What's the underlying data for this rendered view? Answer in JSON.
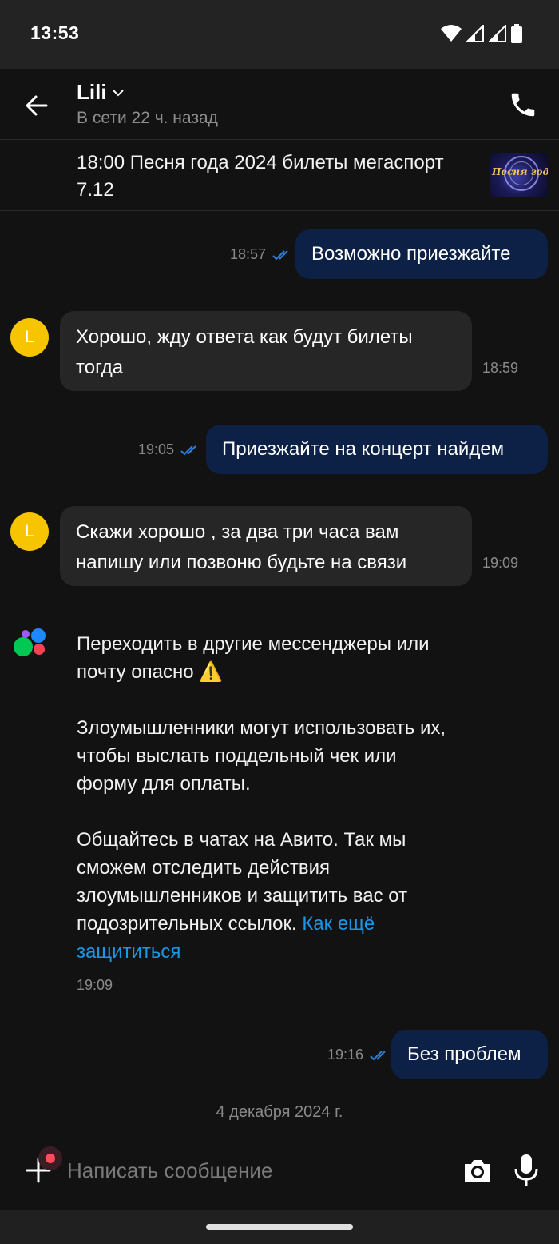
{
  "status_bar": {
    "time": "13:53"
  },
  "header": {
    "contact_name": "Lili",
    "contact_status": "В сети 22 ч. назад"
  },
  "listing": {
    "title": "18:00 Песня года 2024 билеты мегаспорт 7.12",
    "thumbnail_text": "Песня года"
  },
  "messages": [
    {
      "direction": "out",
      "text": "Возможно приезжайте",
      "time": "18:57",
      "status": "read"
    },
    {
      "direction": "in",
      "avatar": "L",
      "text": "Хорошо, жду ответа как будут билеты тогда",
      "time": "18:59"
    },
    {
      "direction": "out",
      "text": "Приезжайте на концерт найдем",
      "time": "19:05",
      "status": "read"
    },
    {
      "direction": "in",
      "avatar": "L",
      "text": "Скажи хорошо , за два три часа вам напишу или позвоню будьте на связи",
      "time": "19:09"
    },
    {
      "direction": "out",
      "text": "Без проблем",
      "time": "19:16",
      "status": "read"
    }
  ],
  "system_message": {
    "paragraph1": "Переходить в другие мессенджеры или почту опасно ⚠️",
    "paragraph2": "Злоумышленники могут использовать их, чтобы выслать поддельный чек или форму для оплаты.",
    "paragraph3": "Общайтесь в чатах на Авито. Так мы сможем отследить действия злоумышленников и защитить вас от подозрительных ссылок.",
    "link_text": "Как ещё защититься",
    "time": "19:09"
  },
  "date_separator": "4 декабря 2024 г.",
  "composer": {
    "placeholder": "Написать сообщение"
  },
  "colors": {
    "background": "#121212",
    "outgoing_bubble": "#0d2146",
    "incoming_bubble": "#262626",
    "avatar": "#f7c400",
    "link": "#1a97e6",
    "read_ticks": "#2f7fd6"
  },
  "icons": [
    "wifi-icon",
    "signal-icon",
    "battery-icon",
    "back-arrow-icon",
    "chevron-down-icon",
    "phone-icon",
    "double-check-icon",
    "avito-logo-icon",
    "plus-icon",
    "camera-icon",
    "microphone-icon"
  ]
}
